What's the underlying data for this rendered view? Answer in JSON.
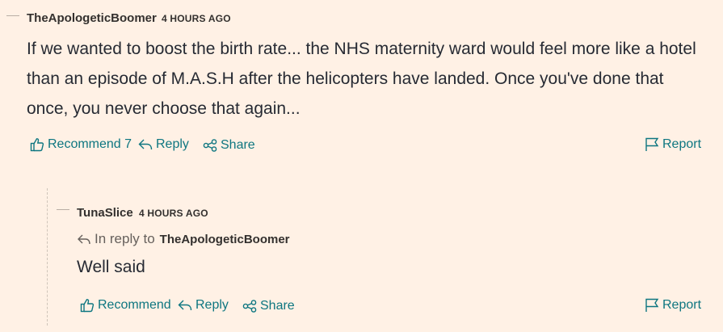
{
  "comments": [
    {
      "author": "TheApologeticBoomer",
      "time": "4 HOURS AGO",
      "body_lines": [
        "If we wanted to boost the birth rate... the NHS maternity ward would feel more like a hotel",
        "than an episode of M.A.S.H after the helicopters have landed. Once you've done that",
        "once, you never choose that again..."
      ],
      "actions": {
        "recommend": "Recommend 7",
        "reply": "Reply",
        "share": "Share",
        "report": "Report"
      }
    },
    {
      "author": "TunaSlice",
      "time": "4 HOURS AGO",
      "in_reply_to_label": "In reply to",
      "in_reply_to_name": "TheApologeticBoomer",
      "body": "Well said",
      "actions": {
        "recommend": "Recommend",
        "reply": "Reply",
        "share": "Share",
        "report": "Report"
      }
    }
  ],
  "colors": {
    "background": "#fff1e5",
    "accent": "#0d7680",
    "text": "#33302e"
  },
  "icons": [
    "thumbs-up-icon",
    "reply-arrow-icon",
    "share-icon",
    "flag-icon"
  ]
}
